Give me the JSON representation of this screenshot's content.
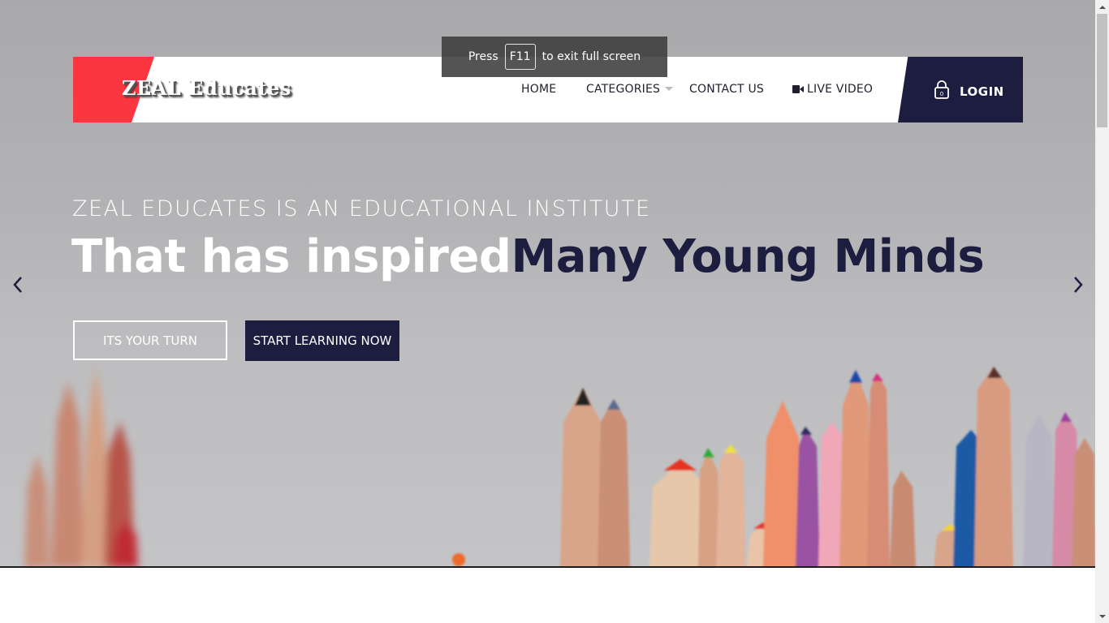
{
  "brand": {
    "name": "ZEAL Educates"
  },
  "nav": {
    "home": "HOME",
    "categories": "CATEGORIES",
    "contact": "CONTACT US",
    "live_video": "LIVE VIDEO",
    "login": "LOGIN"
  },
  "fullscreen_toast": {
    "prefix": "Press",
    "key": "F11",
    "suffix": "to exit full screen"
  },
  "hero": {
    "subtitle": "ZEAL EDUCATES IS AN EDUCATIONAL INSTITUTE",
    "headline_part1": "That has inspired",
    "headline_part2": "Many Young Minds",
    "button_primary": "ITS YOUR TURN",
    "button_secondary": "START LEARNING NOW"
  },
  "colors": {
    "brand_red": "#fb3640",
    "navy": "#1d1d40",
    "hero_bg": "#b2b2b4"
  },
  "icons": [
    "video-camera-icon",
    "lock-icon",
    "chevron-left-icon",
    "chevron-right-icon",
    "caret-down-icon"
  ]
}
